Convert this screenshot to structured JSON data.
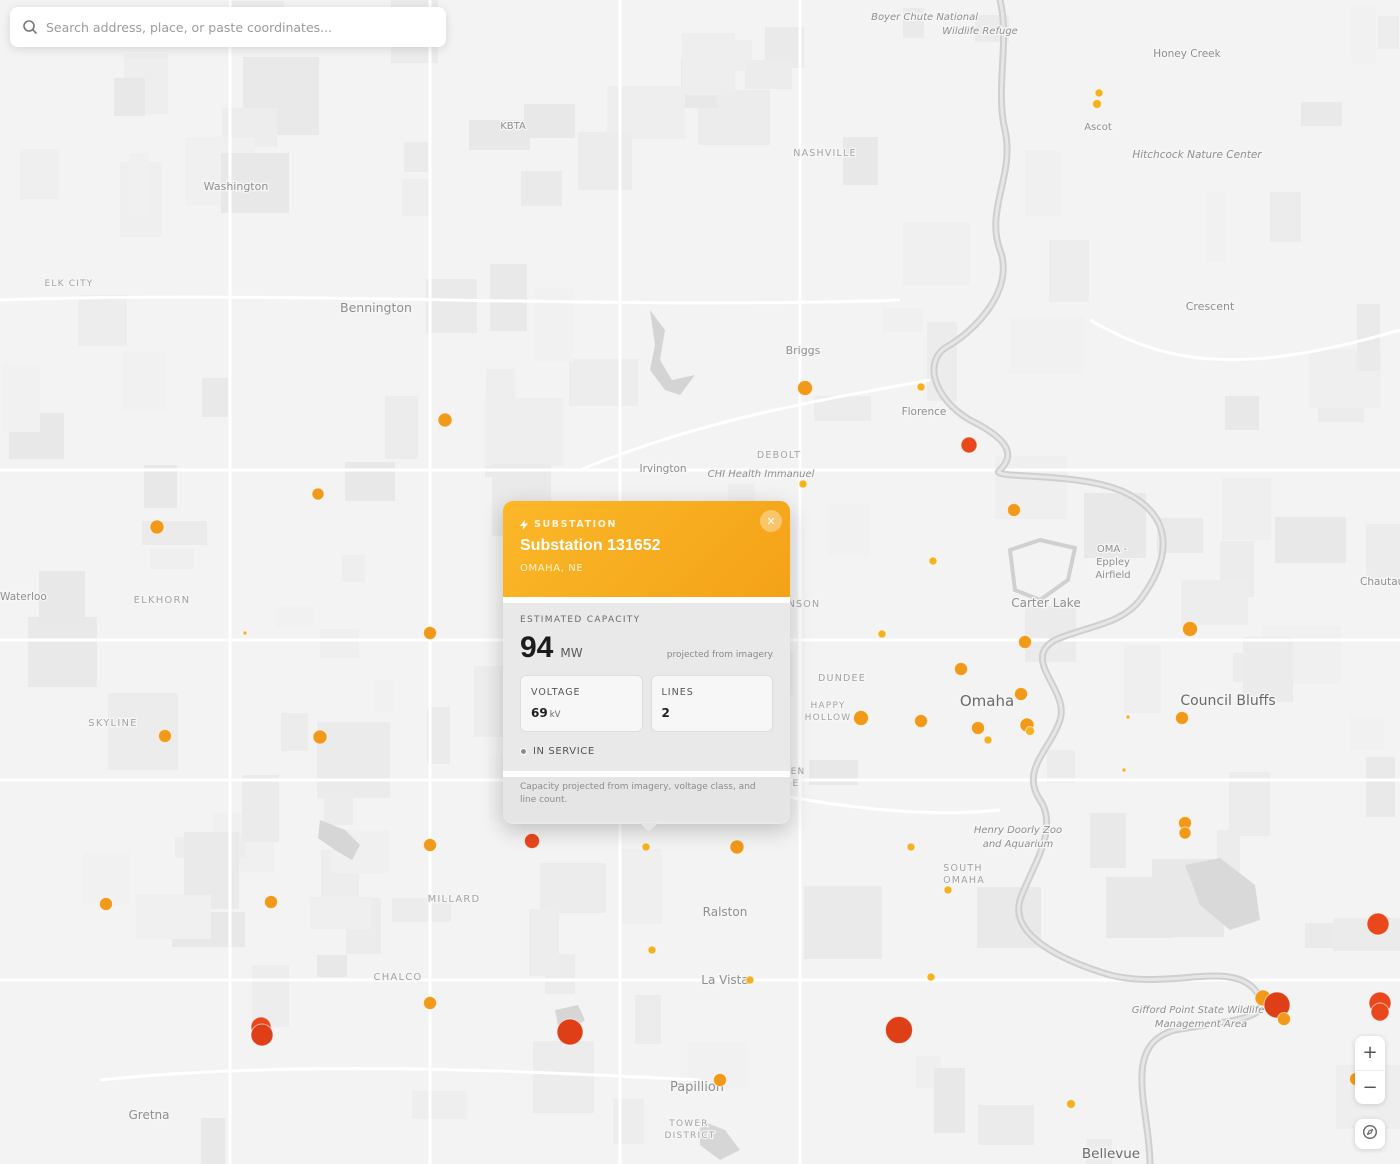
{
  "search": {
    "placeholder": "Search address, place, or paste coordinates..."
  },
  "map": {
    "place_labels": [
      {
        "name": "Boyer Chute National",
        "style": "italic"
      },
      {
        "name": "Wildlife Refuge",
        "style": "italic"
      },
      {
        "name": "Honey Creek",
        "style": "small"
      },
      {
        "name": "KBTA",
        "style": "poi"
      },
      {
        "name": "Ascot",
        "style": "small"
      },
      {
        "name": "NASHVILLE",
        "style": "district"
      },
      {
        "name": "Hitchcock Nature Center",
        "style": "italic"
      },
      {
        "name": "Washington",
        "style": "small"
      },
      {
        "name": "ELK CITY",
        "style": "district"
      },
      {
        "name": "Bennington",
        "style": "town"
      },
      {
        "name": "Crescent",
        "style": "small"
      },
      {
        "name": "Briggs",
        "style": "small"
      },
      {
        "name": "Florence",
        "style": "small"
      },
      {
        "name": "DEBOLT",
        "style": "district"
      },
      {
        "name": "Irvington",
        "style": "small"
      },
      {
        "name": "CHI Health Immanuel",
        "style": "italic"
      },
      {
        "name": "OMA -",
        "style": "poi"
      },
      {
        "name": "Eppley",
        "style": "poi"
      },
      {
        "name": "Airfield",
        "style": "poi"
      },
      {
        "name": "Chautau",
        "style": "small"
      },
      {
        "name": "Waterloo",
        "style": "small"
      },
      {
        "name": "ELKHORN",
        "style": "district"
      },
      {
        "name": "NSON",
        "style": "district"
      },
      {
        "name": "Carter Lake",
        "style": "town"
      },
      {
        "name": "DUNDEE",
        "style": "district"
      },
      {
        "name": "Omaha",
        "style": "city"
      },
      {
        "name": "Council Bluffs",
        "style": "city"
      },
      {
        "name": "HAPPY",
        "style": "district"
      },
      {
        "name": "HOLLOW",
        "style": "district"
      },
      {
        "name": "SKYLINE",
        "style": "district"
      },
      {
        "name": "EN",
        "style": "district"
      },
      {
        "name": "E",
        "style": "district"
      },
      {
        "name": "Henry Doorly Zoo",
        "style": "italic"
      },
      {
        "name": "and Aquarium",
        "style": "italic"
      },
      {
        "name": "SOUTH",
        "style": "district"
      },
      {
        "name": "OMAHA",
        "style": "district"
      },
      {
        "name": "MILLARD",
        "style": "district"
      },
      {
        "name": "Ralston",
        "style": "town"
      },
      {
        "name": "CHALCO",
        "style": "district"
      },
      {
        "name": "La Vista",
        "style": "town"
      },
      {
        "name": "Gifford Point State Wildlife",
        "style": "italic"
      },
      {
        "name": "Management Area",
        "style": "italic"
      },
      {
        "name": "Papillion",
        "style": "town"
      },
      {
        "name": "TOWER",
        "style": "district"
      },
      {
        "name": "DISTRICT",
        "style": "district"
      },
      {
        "name": "Gretna",
        "style": "town"
      },
      {
        "name": "Bellevue",
        "style": "city"
      }
    ],
    "marker_colors": {
      "small": "#f6b21e",
      "medium": "#f19a1a",
      "large": "#e8481c",
      "xlarge": "#df3f17"
    }
  },
  "popup": {
    "kicker": "SUBSTATION",
    "title": "Substation 131652",
    "location": "OMAHA, NE",
    "capacity_label": "ESTIMATED CAPACITY",
    "capacity_value": "94",
    "capacity_unit": "MW",
    "capacity_note": "projected from imagery",
    "voltage_label": "VOLTAGE",
    "voltage_value": "69",
    "voltage_unit": "kV",
    "lines_label": "LINES",
    "lines_value": "2",
    "status": "IN SERVICE",
    "footnote": "Capacity projected from imagery, voltage class, and line count.",
    "close_icon": "close-icon",
    "header_color": "#f7a91f"
  },
  "controls": {
    "zoom_in": "+",
    "zoom_out": "−",
    "compass_icon": "compass-icon"
  }
}
